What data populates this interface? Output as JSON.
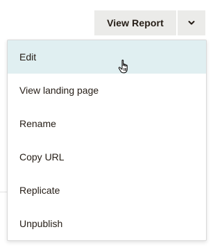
{
  "split_button": {
    "label": "View Report",
    "caret_icon": "chevron-down-icon"
  },
  "menu": {
    "items": [
      {
        "label": "Edit",
        "active": true
      },
      {
        "label": "View landing page"
      },
      {
        "label": "Rename"
      },
      {
        "label": "Copy URL"
      },
      {
        "label": "Replicate"
      },
      {
        "label": "Unpublish"
      }
    ]
  },
  "colors": {
    "button_bg": "#ebebe9",
    "active_item_bg": "#e0eff1",
    "text": "#241c15"
  },
  "cursor_icon": "hand-pointer-icon"
}
